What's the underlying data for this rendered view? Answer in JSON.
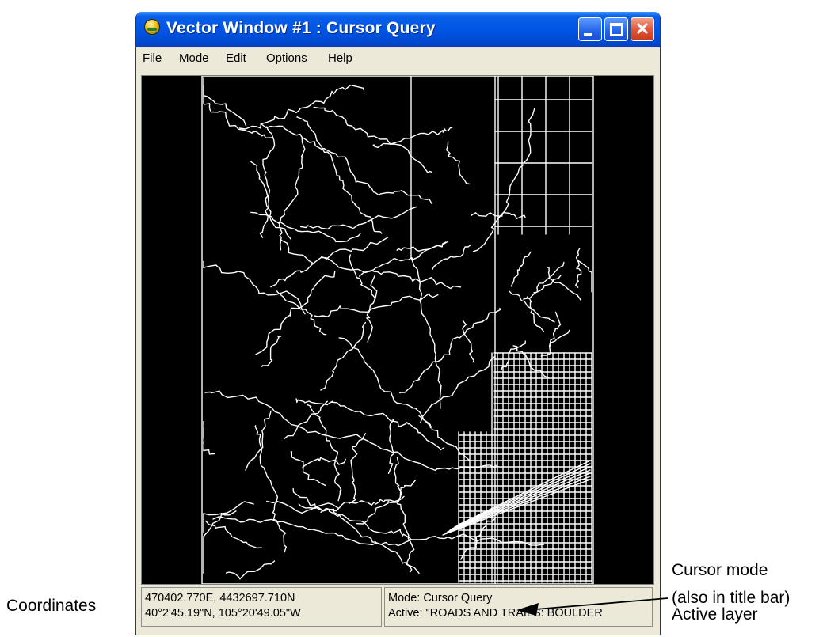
{
  "window": {
    "title": "Vector Window #1 : Cursor Query",
    "menu": [
      "File",
      "Mode",
      "Edit",
      "Options",
      "Help"
    ],
    "status": {
      "coord_utm": "470402.770E, 4432697.710N",
      "coord_geo": "40°2'45.19\"N, 105°20'49.05\"W",
      "mode": "Mode: Cursor Query",
      "active": "Active: \"ROADS AND TRAILS: BOULDER"
    }
  },
  "annotations": {
    "coordinates": "Coordinates",
    "cursor_mode_line1": "Cursor mode",
    "cursor_mode_line2": "(also in title bar)",
    "active_layer": "Active layer"
  },
  "colors": {
    "titlebar": "#0055e5",
    "window_bg": "#ece9d8",
    "map_bg": "#000000",
    "map_lines": "#ffffff"
  }
}
